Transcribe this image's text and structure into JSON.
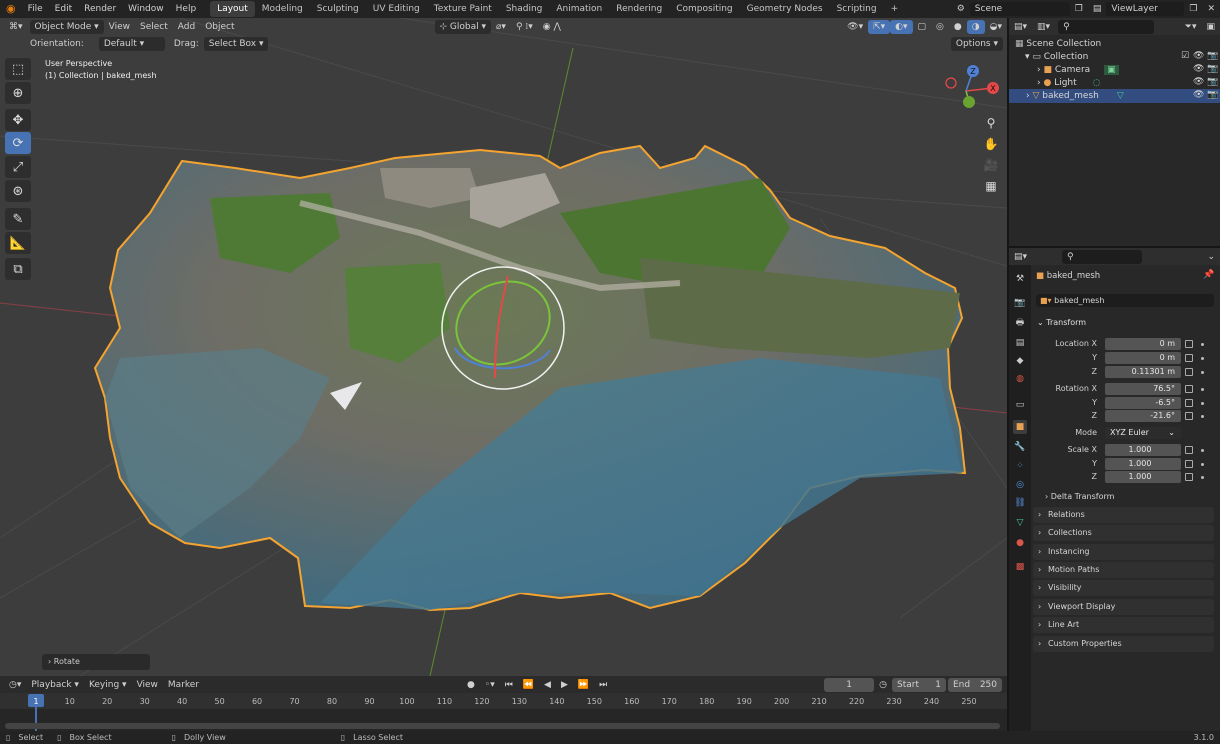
{
  "topbar": {
    "menus": [
      "File",
      "Edit",
      "Render",
      "Window",
      "Help"
    ],
    "workspaces": [
      "Layout",
      "Modeling",
      "Sculpting",
      "UV Editing",
      "Texture Paint",
      "Shading",
      "Animation",
      "Rendering",
      "Compositing",
      "Geometry Nodes",
      "Scripting"
    ],
    "active_workspace": "Layout",
    "add_tab": "+",
    "scene": "Scene",
    "view_layer": "ViewLayer"
  },
  "viewport": {
    "mode": "Object Mode",
    "menus": [
      "View",
      "Select",
      "Add",
      "Object"
    ],
    "transform_orientation": "Global",
    "options_label": "Options",
    "orientation_label": "Orientation:",
    "orientation_value": "Default",
    "drag_label": "Drag:",
    "drag_value": "Select Box",
    "overlay_line1": "User Perspective",
    "overlay_line2": "(1) Collection | baked_mesh",
    "last_op": "Rotate",
    "gizmo_axes": {
      "z": "Z",
      "x": "X"
    }
  },
  "timeline": {
    "menus": [
      "Playback",
      "Keying",
      "View",
      "Marker"
    ],
    "current_frame": "1",
    "start_label": "Start",
    "start": "1",
    "end_label": "End",
    "end": "250",
    "ticks": [
      "1",
      "10",
      "20",
      "30",
      "40",
      "50",
      "60",
      "70",
      "80",
      "90",
      "100",
      "110",
      "120",
      "130",
      "140",
      "150",
      "160",
      "170",
      "180",
      "190",
      "200",
      "210",
      "220",
      "230",
      "240",
      "250"
    ]
  },
  "outliner": {
    "root": "Scene Collection",
    "collection": "Collection",
    "items": [
      "Camera",
      "Light",
      "baked_mesh"
    ],
    "selected": "baked_mesh"
  },
  "properties": {
    "object_name": "baked_mesh",
    "datablock": "baked_mesh",
    "transform_label": "Transform",
    "location_label_x": "Location X",
    "location_x": "0 m",
    "y_label": "Y",
    "z_label": "Z",
    "location_y": "0 m",
    "location_z": "0.11301 m",
    "rotation_label_x": "Rotation X",
    "rotation_x": "76.5°",
    "rotation_y": "-6.5°",
    "rotation_z": "-21.6°",
    "mode_label": "Mode",
    "mode_value": "XYZ Euler",
    "scale_label_x": "Scale X",
    "scale_x": "1.000",
    "scale_y": "1.000",
    "scale_z": "1.000",
    "delta": "Delta Transform",
    "panels": [
      "Relations",
      "Collections",
      "Instancing",
      "Motion Paths",
      "Visibility",
      "Viewport Display",
      "Line Art",
      "Custom Properties"
    ]
  },
  "statusbar": {
    "select": "Select",
    "box_select": "Box Select",
    "dolly": "Dolly View",
    "lasso": "Lasso Select",
    "version": "3.1.0"
  },
  "colors": {
    "accent": "#4772b3",
    "selection_outline": "#f5a430",
    "viewport_bg": "#3d3d3d",
    "panel_bg": "#282828"
  }
}
